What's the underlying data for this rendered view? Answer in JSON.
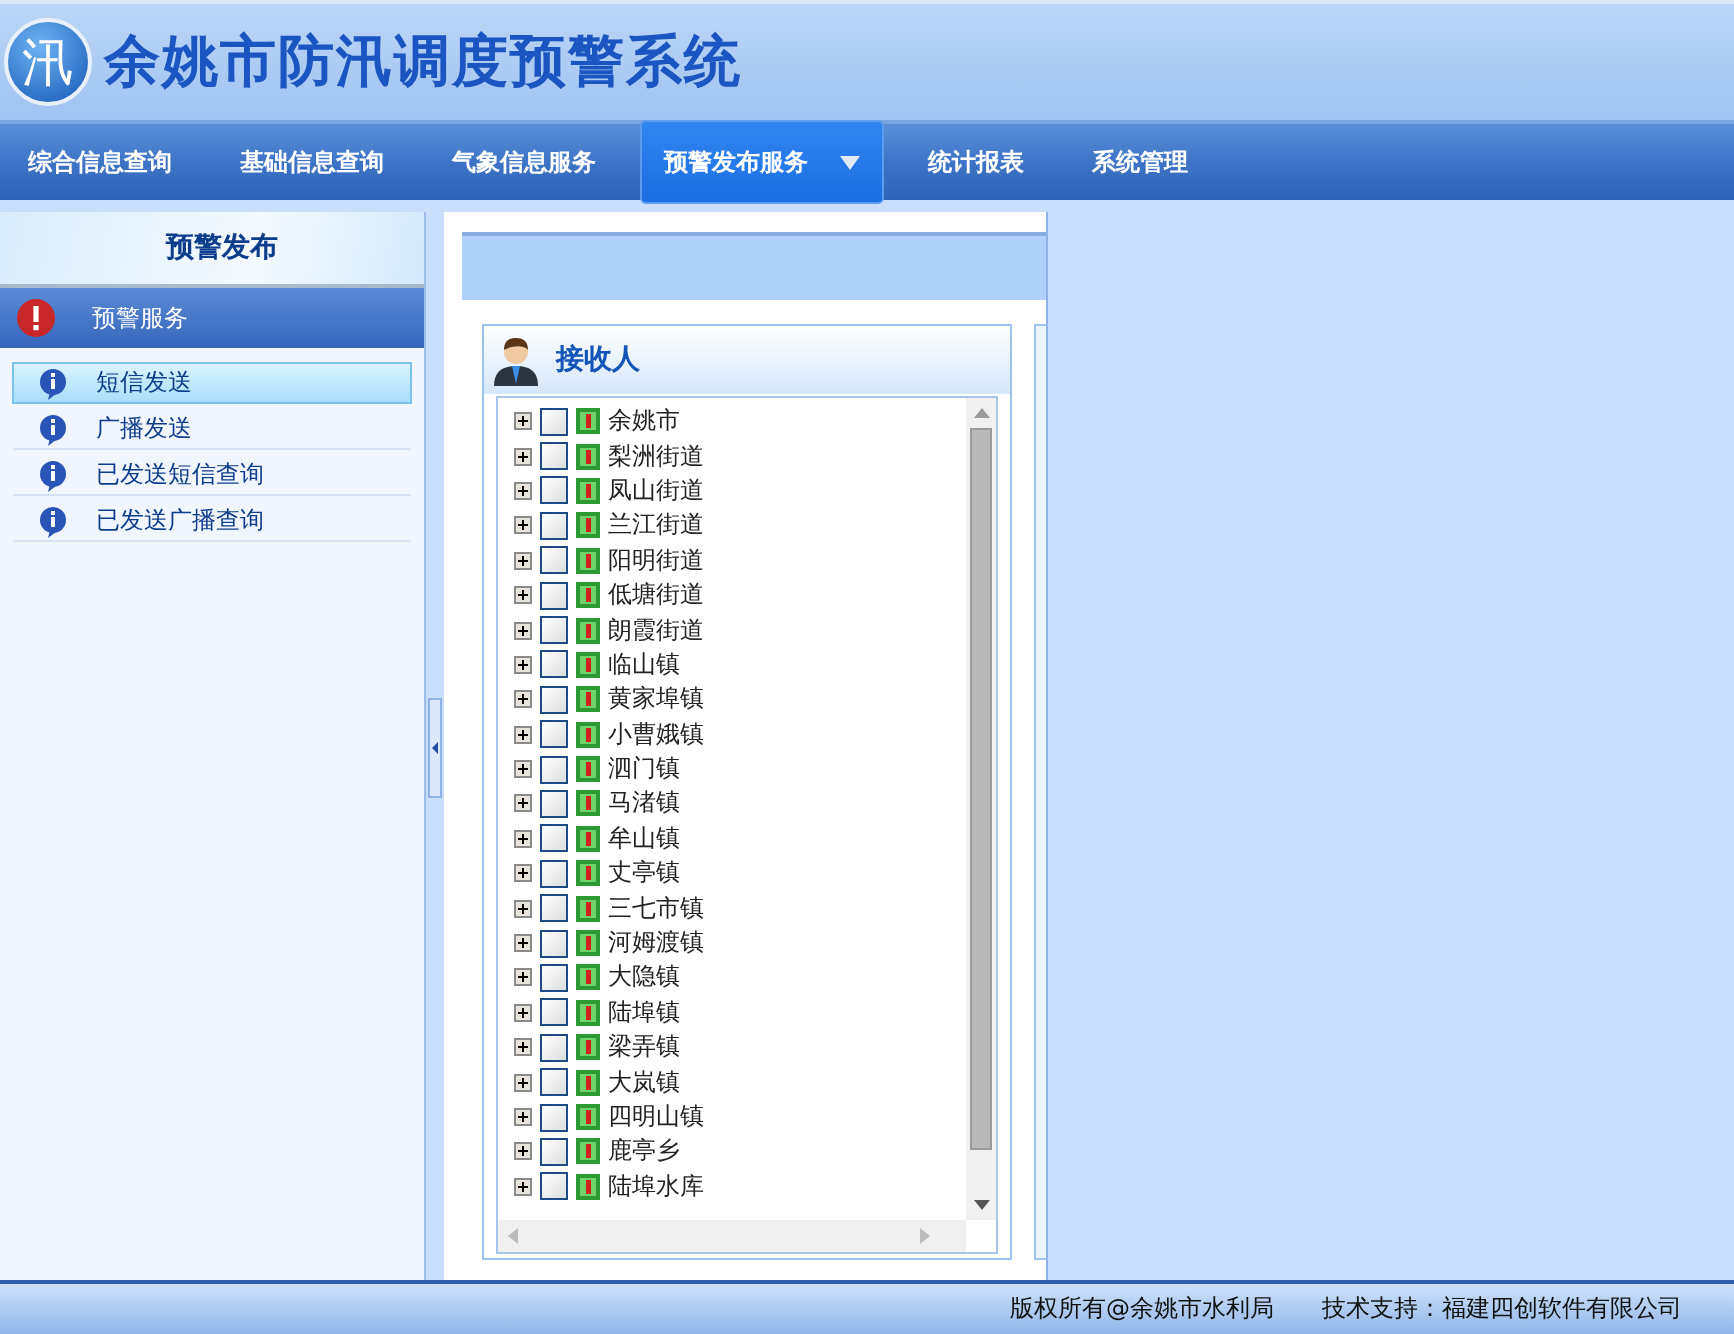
{
  "header": {
    "logo_char": "汛",
    "title": "余姚市防汛调度预警系统"
  },
  "nav": [
    {
      "label": "综合信息查询",
      "selected": false,
      "has_menu": false
    },
    {
      "label": "基础信息查询",
      "selected": false,
      "has_menu": false
    },
    {
      "label": "气象信息服务",
      "selected": false,
      "has_menu": false
    },
    {
      "label": "预警发布服务",
      "selected": true,
      "has_menu": true
    },
    {
      "label": "统计报表",
      "selected": false,
      "has_menu": false
    },
    {
      "label": "系统管理",
      "selected": false,
      "has_menu": false
    }
  ],
  "sidebar": {
    "title": "预警发布",
    "group": "预警服务",
    "items": [
      {
        "label": "短信发送",
        "selected": true
      },
      {
        "label": "广播发送",
        "selected": false
      },
      {
        "label": "已发送短信查询",
        "selected": false
      },
      {
        "label": "已发送广播查询",
        "selected": false
      }
    ]
  },
  "receivers": {
    "title": "接收人",
    "items": [
      {
        "label": "余姚市",
        "checked": false,
        "expanded": false
      },
      {
        "label": "梨洲街道",
        "checked": false,
        "expanded": false
      },
      {
        "label": "凤山街道",
        "checked": false,
        "expanded": false
      },
      {
        "label": "兰江街道",
        "checked": false,
        "expanded": false
      },
      {
        "label": "阳明街道",
        "checked": false,
        "expanded": false
      },
      {
        "label": "低塘街道",
        "checked": false,
        "expanded": false
      },
      {
        "label": "朗霞街道",
        "checked": false,
        "expanded": false
      },
      {
        "label": "临山镇",
        "checked": false,
        "expanded": false
      },
      {
        "label": "黄家埠镇",
        "checked": false,
        "expanded": false
      },
      {
        "label": "小曹娥镇",
        "checked": false,
        "expanded": false
      },
      {
        "label": "泗门镇",
        "checked": false,
        "expanded": false
      },
      {
        "label": "马渚镇",
        "checked": false,
        "expanded": false
      },
      {
        "label": "牟山镇",
        "checked": false,
        "expanded": false
      },
      {
        "label": "丈亭镇",
        "checked": false,
        "expanded": false
      },
      {
        "label": "三七市镇",
        "checked": false,
        "expanded": false
      },
      {
        "label": "河姆渡镇",
        "checked": false,
        "expanded": false
      },
      {
        "label": "大隐镇",
        "checked": false,
        "expanded": false
      },
      {
        "label": "陆埠镇",
        "checked": false,
        "expanded": false
      },
      {
        "label": "梁弄镇",
        "checked": false,
        "expanded": false
      },
      {
        "label": "大岚镇",
        "checked": false,
        "expanded": false
      },
      {
        "label": "四明山镇",
        "checked": false,
        "expanded": false
      },
      {
        "label": "鹿亭乡",
        "checked": false,
        "expanded": false
      },
      {
        "label": "陆埠水库",
        "checked": false,
        "expanded": false
      }
    ]
  },
  "footer": {
    "copyright": "版权所有@余姚市水利局",
    "support": "技术支持：福建四创软件有限公司"
  }
}
